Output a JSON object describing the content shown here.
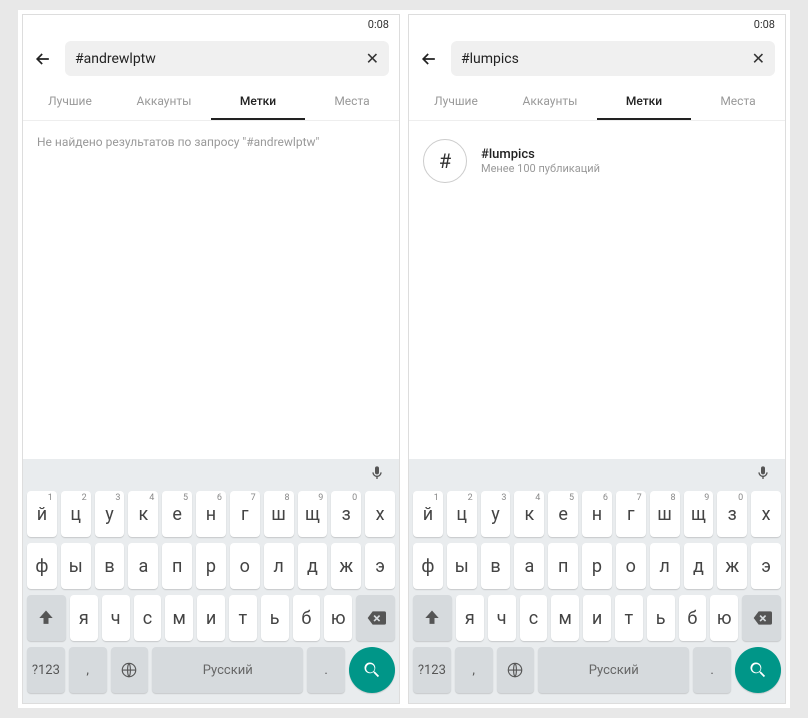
{
  "status_time": "0:08",
  "tabs": [
    "Лучшие",
    "Аккаунты",
    "Метки",
    "Места"
  ],
  "screens": [
    {
      "search_value": "#andrewlptw",
      "no_results": "Не найдено результатов по запросу \"#andrewlptw\"",
      "result": null
    },
    {
      "search_value": "#lumpics",
      "no_results": null,
      "result": {
        "tag": "#lumpics",
        "sub": "Менее 100 публикаций"
      }
    }
  ],
  "keyboard": {
    "row1": [
      {
        "l": "й",
        "s": "1"
      },
      {
        "l": "ц",
        "s": "2"
      },
      {
        "l": "у",
        "s": "3"
      },
      {
        "l": "к",
        "s": "4"
      },
      {
        "l": "е",
        "s": "5"
      },
      {
        "l": "н",
        "s": "6"
      },
      {
        "l": "г",
        "s": "7"
      },
      {
        "l": "ш",
        "s": "8"
      },
      {
        "l": "щ",
        "s": "9"
      },
      {
        "l": "з",
        "s": "0"
      },
      {
        "l": "х",
        "s": ""
      }
    ],
    "row2": [
      "ф",
      "ы",
      "в",
      "а",
      "п",
      "р",
      "о",
      "л",
      "д",
      "ж",
      "э"
    ],
    "row3": [
      "я",
      "ч",
      "с",
      "м",
      "и",
      "т",
      "ь",
      "б",
      "ю"
    ],
    "sym": "?123",
    "space": "Русский",
    "comma": ",",
    "period": "."
  }
}
